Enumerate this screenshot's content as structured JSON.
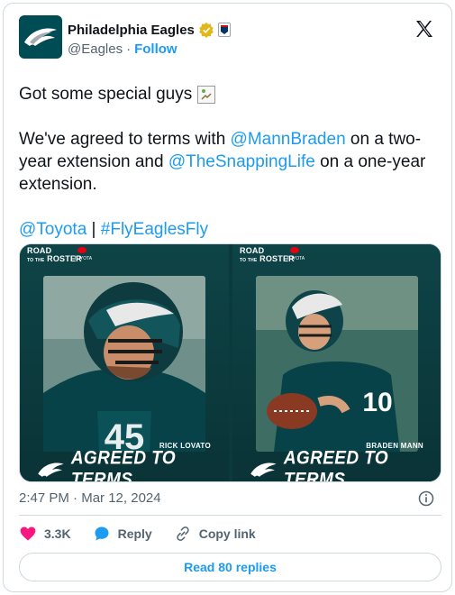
{
  "account": {
    "name": "Philadelphia Eagles",
    "handle": "@Eagles",
    "separator": "·",
    "follow_label": "Follow"
  },
  "tweet": {
    "line1": "Got some special guys",
    "line2_pre": "We've agreed to terms with ",
    "mention1": "@MannBraden",
    "line2_mid": " on a two-year extension and ",
    "mention2": "@TheSnappingLife",
    "line2_post": " on a one-year extension.",
    "mention3": "@Toyota",
    "tags_sep": " | ",
    "hashtag": "#FlyEaglesFly"
  },
  "media": {
    "sponsor_line1": "ROAD",
    "sponsor_line2": "TO THE",
    "sponsor_line3": "ROSTER",
    "sponsor_brand": "TOYOTA",
    "banner": "AGREED TO TERMS",
    "players": [
      {
        "name": "RICK LOVATO",
        "jersey": "45"
      },
      {
        "name": "BRADEN MANN",
        "jersey": "10"
      }
    ]
  },
  "meta": {
    "time": "2:47 PM",
    "separator": "·",
    "date": "Mar 12, 2024"
  },
  "actions": {
    "like_count": "3.3K",
    "reply_label": "Reply",
    "copy_label": "Copy link"
  },
  "read_replies_label": "Read 80 replies",
  "colors": {
    "accent": "#1d9bf0",
    "like": "#f91880",
    "eagles_green": "#004c54",
    "verified_gold": "#e2b719"
  }
}
